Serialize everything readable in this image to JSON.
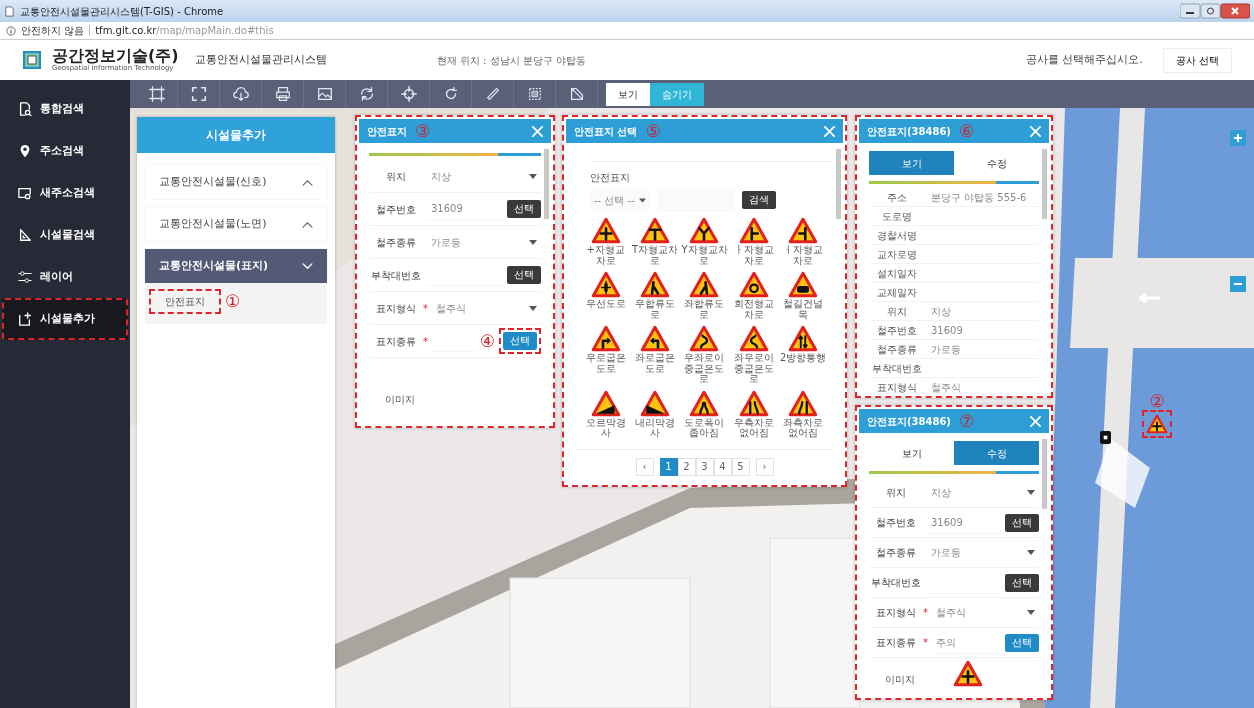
{
  "browser": {
    "title": "교통안전시설물관리시스템(T-GIS) - Chrome",
    "security": "안전하지 않음",
    "host": "tfm.git.co.kr",
    "path": "/map/mapMain.do#this"
  },
  "header": {
    "company": "공간정보기술(주)",
    "tagline": "Geospatial Information Technology",
    "system": "교통안전시설물관리시스템",
    "location": "현재 위치 : 성남시 분당구 야탑동",
    "prompt": "공사를 선택해주십시오.",
    "button": "공사 선택"
  },
  "sidebar": {
    "items": [
      {
        "label": "통합검색",
        "kind": "search-doc",
        "selected": false,
        "highlighted": false
      },
      {
        "label": "주소검색",
        "kind": "pin",
        "selected": false,
        "highlighted": false
      },
      {
        "label": "새주소검색",
        "kind": "map-search",
        "selected": false,
        "highlighted": false
      },
      {
        "label": "시설물검색",
        "kind": "set-square",
        "selected": false,
        "highlighted": false
      },
      {
        "label": "레이어",
        "kind": "sliders",
        "selected": false,
        "highlighted": false
      },
      {
        "label": "시설물추가",
        "kind": "add-doc",
        "selected": true,
        "highlighted": true
      }
    ]
  },
  "toolbar": {
    "tools": [
      {
        "kind": "frame"
      },
      {
        "kind": "expand"
      },
      {
        "kind": "cloud"
      },
      {
        "kind": "print"
      },
      {
        "kind": "image"
      },
      {
        "kind": "cycle"
      },
      {
        "kind": "target"
      },
      {
        "kind": "rotate"
      },
      {
        "kind": "ruler"
      },
      {
        "kind": "grid"
      },
      {
        "kind": "polygon"
      }
    ],
    "toggle": [
      {
        "label": "보기",
        "selected": false
      },
      {
        "label": "숨기기",
        "selected": true
      }
    ]
  },
  "facility_panel": {
    "title": "시설물추가",
    "groups": [
      {
        "label": "교통안전시설물(신호)",
        "expanded": false
      },
      {
        "label": "교통안전시설물(노면)",
        "expanded": false
      },
      {
        "label": "교통안전시설물(표지)",
        "expanded": true,
        "items": [
          {
            "label": "안전표지",
            "highlighted": true,
            "annotation": "①"
          }
        ]
      }
    ]
  },
  "sign_form": {
    "title": "안전표지",
    "annotation": "③",
    "highlighted": true,
    "fields": [
      {
        "label": "위치",
        "kind": "select",
        "value": "지상"
      },
      {
        "label": "철주번호",
        "kind": "button",
        "value": "31609",
        "button": "선택",
        "primary": false
      },
      {
        "label": "철주종류",
        "kind": "select",
        "value": "가로등"
      },
      {
        "label": "부착대번호",
        "kind": "button",
        "button": "선택",
        "primary": false
      },
      {
        "label": "표지형식",
        "required_mark": "*",
        "kind": "select",
        "value": "철주식"
      },
      {
        "label": "표지종류",
        "required_mark": "*",
        "kind": "button",
        "button": "선택",
        "primary": true,
        "highlighted": true,
        "annotation": "④"
      }
    ],
    "image_label": "이미지"
  },
  "sign_picker": {
    "title": "안전표지 선택",
    "annotation": "⑤",
    "highlighted": true,
    "section": "안전표지",
    "filter": "-- 선택 --",
    "search_button": "검색",
    "signs": [
      {
        "label": "+자형교차로",
        "kind": "cross"
      },
      {
        "label": "T자형교차로",
        "kind": "t"
      },
      {
        "label": "Y자형교차로",
        "kind": "y"
      },
      {
        "label": "ㅏ자형교차로",
        "kind": "t-right"
      },
      {
        "label": "ㅓ자형교차로",
        "kind": "t-left"
      },
      {
        "label": "우선도로",
        "kind": "priority"
      },
      {
        "label": "우합류도로",
        "kind": "merge-right"
      },
      {
        "label": "좌합류도로",
        "kind": "merge-left"
      },
      {
        "label": "회전형교차로",
        "kind": "roundabout"
      },
      {
        "label": "철길건널목",
        "kind": "railroad"
      },
      {
        "label": "우로굽은도로",
        "kind": "curve-right"
      },
      {
        "label": "좌로굽은도로",
        "kind": "curve-left"
      },
      {
        "label": "우좌로이중굽은도로",
        "kind": "double-right"
      },
      {
        "label": "좌우로이중굽은도로",
        "kind": "double-left"
      },
      {
        "label": "2방향통행",
        "kind": "two-way"
      },
      {
        "label": "오르막경사",
        "kind": "uphill"
      },
      {
        "label": "내리막경사",
        "kind": "downhill"
      },
      {
        "label": "도로폭이좁아짐",
        "kind": "narrow"
      },
      {
        "label": "우측차로없어짐",
        "kind": "lane-right"
      },
      {
        "label": "좌측차로없어짐",
        "kind": "lane-left"
      }
    ],
    "pagination": {
      "prev": "‹",
      "next": "›",
      "pages": [
        {
          "label": "1",
          "selected": true
        },
        {
          "label": "2",
          "selected": false
        },
        {
          "label": "3",
          "selected": false
        },
        {
          "label": "4",
          "selected": false
        },
        {
          "label": "5",
          "selected": false
        }
      ]
    }
  },
  "detail_view": {
    "title": "안전표지(38486)",
    "annotation": "⑥",
    "highlighted": true,
    "tabs": [
      {
        "label": "보기",
        "selected": true
      },
      {
        "label": "수정",
        "selected": false
      }
    ],
    "rows": [
      {
        "label": "주소",
        "value": "분당구 야탑동 555-6"
      },
      {
        "label": "도로명"
      },
      {
        "label": "경찰서명"
      },
      {
        "label": "교차로명"
      },
      {
        "label": "설치일자"
      },
      {
        "label": "교체일자"
      },
      {
        "label": "위치",
        "value": "지상"
      },
      {
        "label": "철주번호",
        "value": "31609"
      },
      {
        "label": "철주종류",
        "value": "가로등"
      },
      {
        "label": "부착대번호"
      },
      {
        "label": "표지형식",
        "value": "철주식"
      }
    ]
  },
  "detail_edit": {
    "title": "안전표지(38486)",
    "annotation": "⑦",
    "highlighted": true,
    "tabs": [
      {
        "label": "보기",
        "selected": false
      },
      {
        "label": "수정",
        "selected": true
      }
    ],
    "fields": [
      {
        "label": "위치",
        "kind": "select",
        "value": "지상"
      },
      {
        "label": "철주번호",
        "kind": "button",
        "value": "31609",
        "button": "선택",
        "primary": false
      },
      {
        "label": "철주종류",
        "kind": "select",
        "value": "가로등"
      },
      {
        "label": "부착대번호",
        "kind": "button",
        "button": "선택",
        "primary": false
      },
      {
        "label": "표지형식",
        "required_mark": "*",
        "kind": "select",
        "value": "철주식"
      },
      {
        "label": "표지종류",
        "required_mark": "*",
        "kind": "button",
        "value": "주의",
        "button": "선택",
        "primary": true
      }
    ],
    "image_label": "이미지",
    "image": {
      "kind": "cross"
    }
  },
  "map": {
    "marker": {
      "annotation": "②",
      "kind": "cross",
      "highlighted": true
    }
  }
}
